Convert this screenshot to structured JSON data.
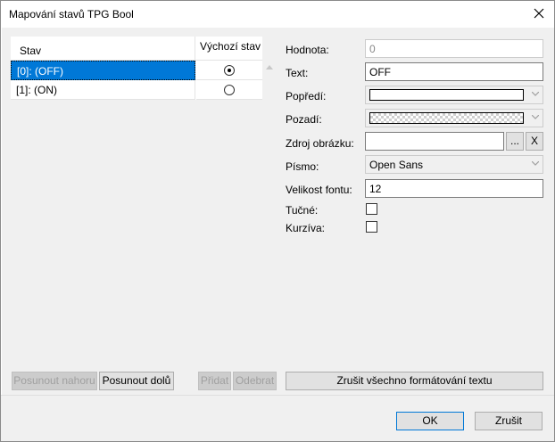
{
  "window": {
    "title": "Mapování stavů TPG Bool",
    "close_glyph": "✕"
  },
  "grid": {
    "columns": [
      "Stav",
      "Výchozí stav"
    ],
    "rows": [
      {
        "label": "[0]: (OFF)",
        "default": true,
        "selected": true
      },
      {
        "label": "[1]: (ON)",
        "default": false,
        "selected": false
      }
    ]
  },
  "left_buttons": {
    "move_up": "Posunout nahoru",
    "move_down": "Posunout dolů",
    "add": "Přidat",
    "remove": "Odebrat"
  },
  "form": {
    "value_label": "Hodnota:",
    "value": "0",
    "text_label": "Text:",
    "text": "OFF",
    "foreground_label": "Popředí:",
    "background_label": "Pozadí:",
    "image_source_label": "Zdroj obrázku:",
    "image_source": "",
    "browse": "...",
    "clear": "X",
    "font_label": "Písmo:",
    "font": "Open Sans",
    "font_size_label": "Velikost fontu:",
    "font_size": "12",
    "bold_label": "Tučné:",
    "italic_label": "Kurzíva:",
    "reset_formatting": "Zrušit všechno formátování textu"
  },
  "footer": {
    "ok": "OK",
    "cancel": "Zrušit"
  }
}
